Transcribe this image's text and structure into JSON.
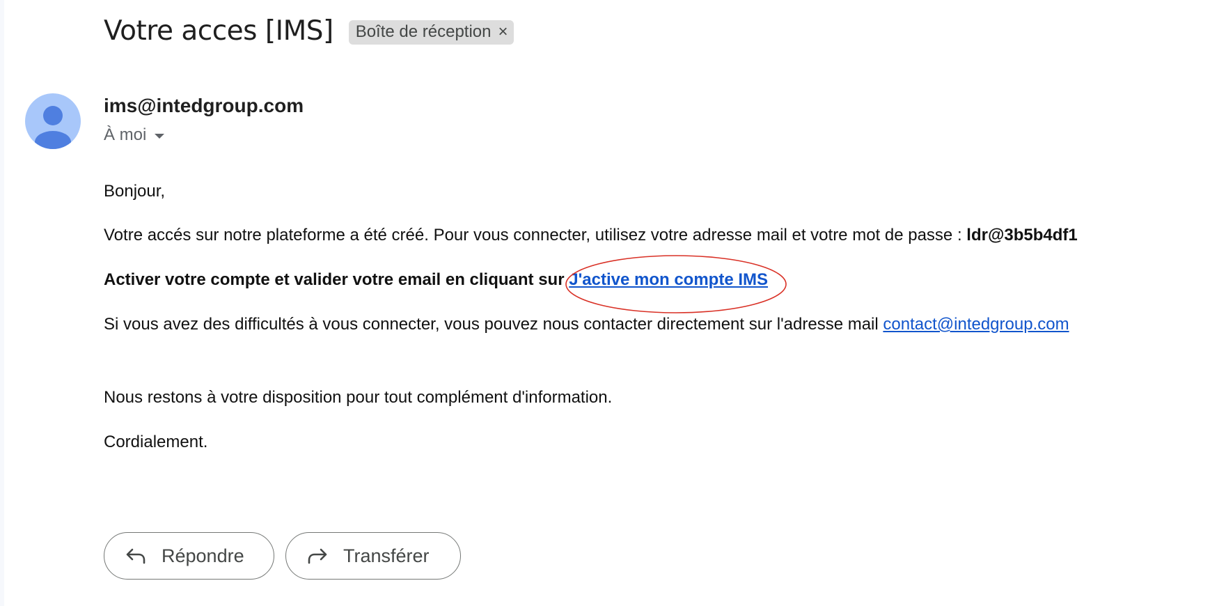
{
  "email": {
    "subject": "Votre acces [IMS]",
    "label_chip": "Boîte de réception",
    "chip_close_glyph": "×",
    "sender": "ims@intedgroup.com",
    "recipient_text": "À moi",
    "greeting": "Bonjour,",
    "para1": "Votre accés sur notre plateforme a été créé. Pour vous connecter, utilisez votre adresse mail et votre mot de passe : ",
    "password": "ldr@3b5b4df1",
    "activation_text": "Activer votre compte et valider votre email en cliquant sur ",
    "activation_link": "J'active mon compte IMS",
    "contact_text": "Si vous avez des difficultés à vous connecter, vous pouvez nous contacter directement sur l'adresse mail ",
    "contact_email": "contact@intedgroup.com",
    "closing1": "Nous restons à votre disposition pour tout complément d'information.",
    "closing2": "Cordialement."
  },
  "actions": {
    "reply_label": "Répondre",
    "forward_label": "Transférer"
  },
  "icons": {
    "avatar": "person-avatar-icon",
    "recipient_toggle": "caret-down-icon",
    "reply": "reply-arrow-icon",
    "forward": "forward-arrow-icon"
  },
  "colors": {
    "link": "#1155cc",
    "annotation_circle": "#d93025",
    "avatar_bg": "#a8c7fa",
    "avatar_figure": "#4f7fe0",
    "chip_bg": "#dddddd"
  }
}
